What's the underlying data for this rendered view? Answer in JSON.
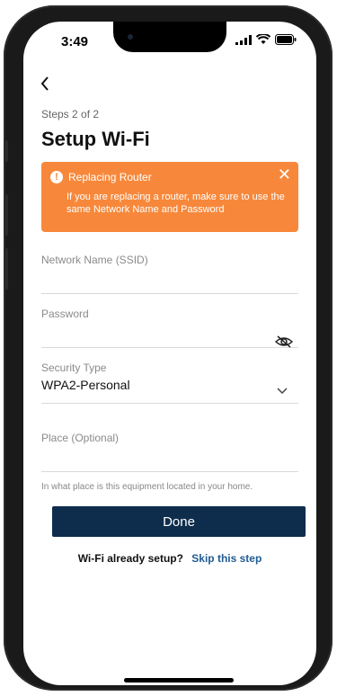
{
  "status_bar": {
    "time": "3:49"
  },
  "header": {
    "steps": "Steps 2 of 2",
    "title": "Setup Wi-Fi"
  },
  "banner": {
    "title": "Replacing Router",
    "message": "If you are replacing a router, make sure to use the same Network Name and Password",
    "icon": "alert-icon",
    "close_icon": "close-icon",
    "color": "#f7883b"
  },
  "form": {
    "ssid_label": "Network Name (SSID)",
    "ssid_value": "",
    "password_label": "Password",
    "password_value": "",
    "security_label": "Security Type",
    "security_value": "WPA2-Personal",
    "place_label": "Place (Optional)",
    "place_value": "",
    "place_hint": "In what place is this equipment located in your home."
  },
  "actions": {
    "done_label": "Done",
    "already_setup": "Wi-Fi already setup?",
    "skip_label": "Skip this step"
  },
  "colors": {
    "button_bg": "#0e2d4c",
    "link": "#1f5c92"
  }
}
